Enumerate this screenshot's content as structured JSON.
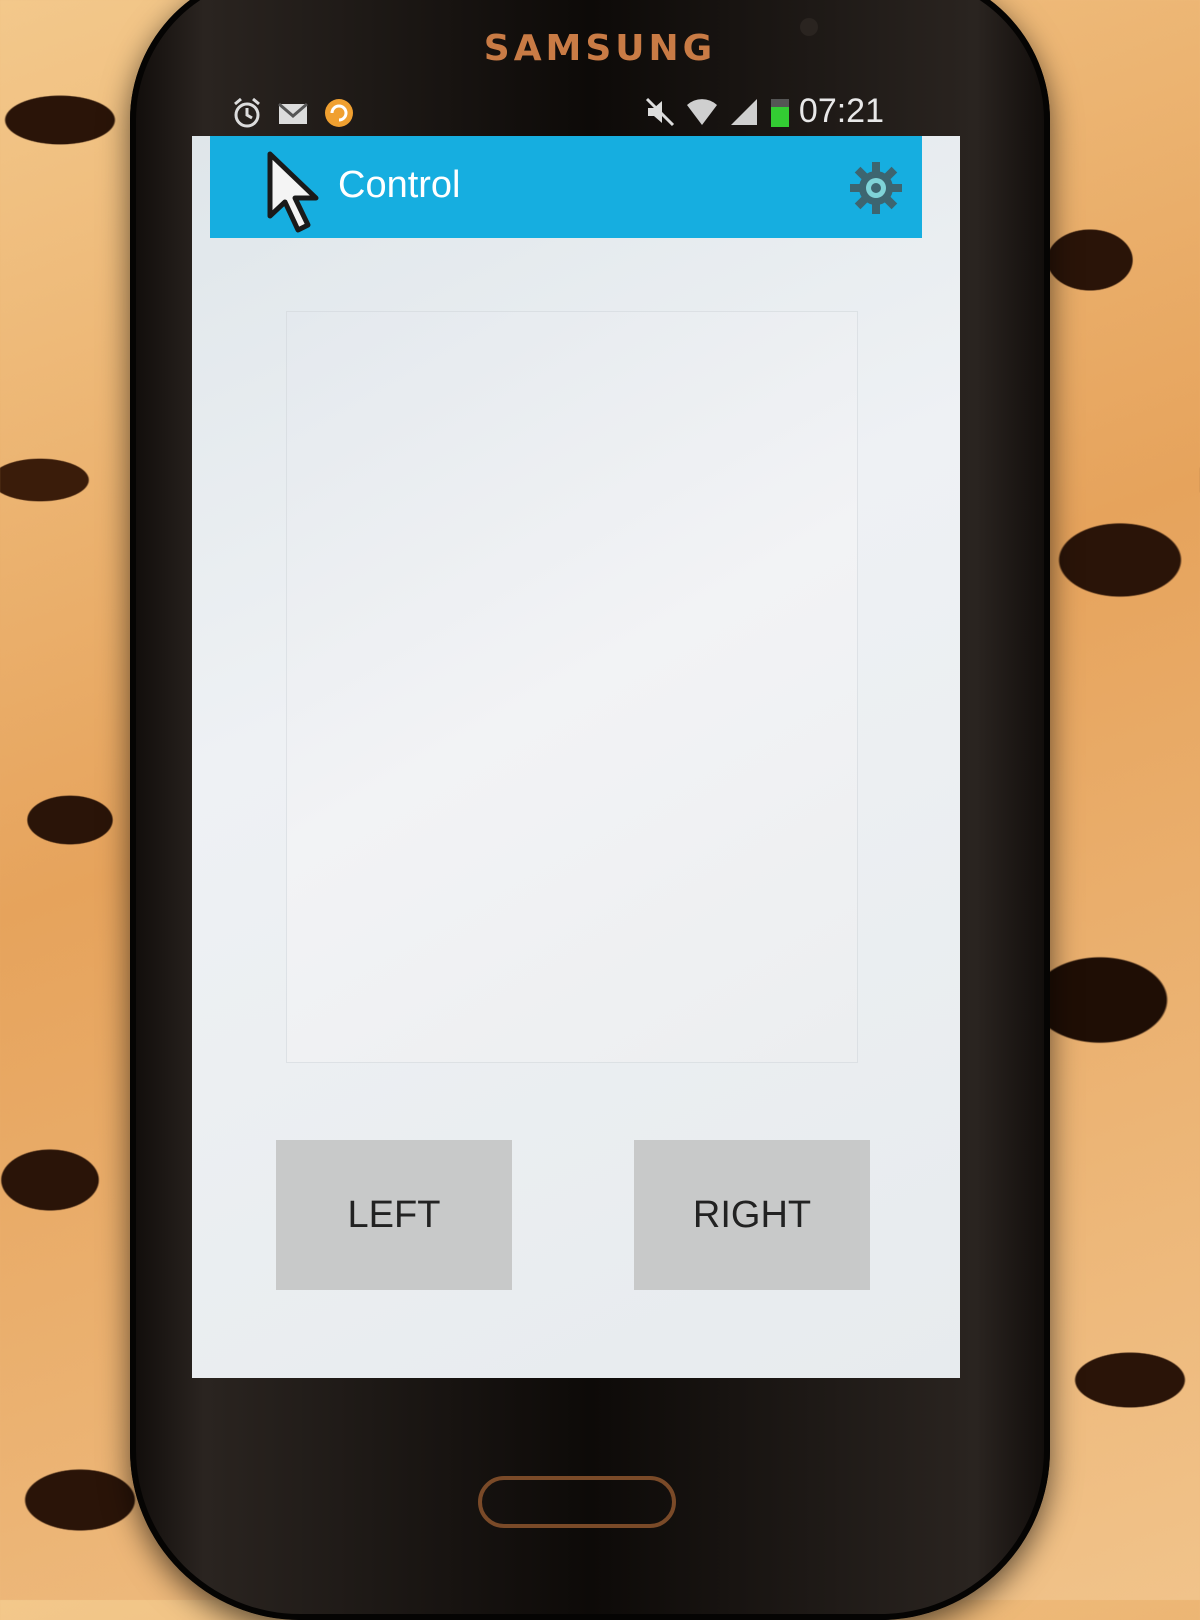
{
  "device": {
    "brand": "SAMSUNG"
  },
  "status_bar": {
    "left_icons": [
      "alarm-icon",
      "gmail-icon",
      "sync-app-icon"
    ],
    "right_icons": [
      "mute-icon",
      "wifi-icon",
      "signal-icon",
      "battery-icon"
    ],
    "time": "07:21"
  },
  "action_bar": {
    "title": "Control",
    "app_icon": "mouse-cursor-icon",
    "settings_icon": "gear-icon",
    "color": "#16aee0"
  },
  "touchpad": {
    "label": ""
  },
  "buttons": {
    "left_label": "LEFT",
    "right_label": "RIGHT"
  }
}
